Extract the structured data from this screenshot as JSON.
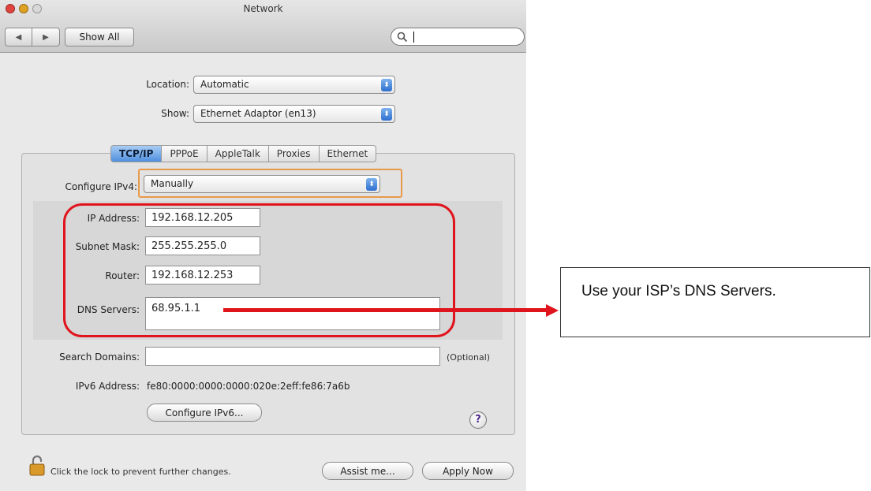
{
  "window": {
    "title": "Network",
    "toolbar": {
      "back": "◀",
      "forward": "▶",
      "show_all": "Show All",
      "search_icon": "magnifying-glass"
    },
    "location_label": "Location:",
    "location_value": "Automatic",
    "show_label": "Show:",
    "show_value": "Ethernet Adaptor (en13)",
    "tabs": [
      {
        "label": "TCP/IP",
        "selected": true
      },
      {
        "label": "PPPoE"
      },
      {
        "label": "AppleTalk"
      },
      {
        "label": "Proxies"
      },
      {
        "label": "Ethernet"
      }
    ],
    "configure_ipv4_label": "Configure IPv4:",
    "configure_ipv4_value": "Manually",
    "fields": {
      "ip_label": "IP Address:",
      "ip_value": "192.168.12.205",
      "subnet_label": "Subnet Mask:",
      "subnet_value": "255.255.255.0",
      "router_label": "Router:",
      "router_value": "192.168.12.253",
      "dns_label": "DNS Servers:",
      "dns_value": "68.95.1.1",
      "search_label": "Search Domains:",
      "search_value": "",
      "optional": "(Optional)",
      "ipv6_label": "IPv6 Address:",
      "ipv6_value": "fe80:0000:0000:0000:020e:2eff:fe86:7a6b"
    },
    "configure_ipv6_button": "Configure IPv6...",
    "help": "?",
    "lock_text": "Click the lock to prevent further changes.",
    "assist_button": "Assist me...",
    "apply_button": "Apply Now"
  },
  "annotation": {
    "text": "Use your ISP’s DNS Servers.",
    "color": "#e0141c"
  }
}
